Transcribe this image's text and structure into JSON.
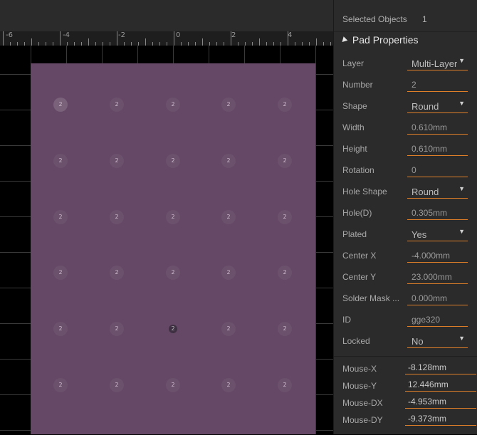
{
  "ruler": {
    "labels": [
      "-6",
      "-4",
      "-2",
      "0",
      "2",
      "4"
    ]
  },
  "pads": {
    "label": "2"
  },
  "panel": {
    "selected_label": "Selected Objects",
    "selected_count": "1",
    "section_title": "Pad Properties",
    "properties": [
      {
        "label": "Layer",
        "value": "Multi-Layer",
        "dropdown": true
      },
      {
        "label": "Number",
        "value": "2",
        "dropdown": false
      },
      {
        "label": "Shape",
        "value": "Round",
        "dropdown": true
      },
      {
        "label": "Width",
        "value": "0.610mm",
        "dropdown": false
      },
      {
        "label": "Height",
        "value": "0.610mm",
        "dropdown": false
      },
      {
        "label": "Rotation",
        "value": "0",
        "dropdown": false
      },
      {
        "label": "Hole Shape",
        "value": "Round",
        "dropdown": true
      },
      {
        "label": "Hole(D)",
        "value": "0.305mm",
        "dropdown": false
      },
      {
        "label": "Plated",
        "value": "Yes",
        "dropdown": true
      },
      {
        "label": "Center X",
        "value": "-4.000mm",
        "dropdown": false
      },
      {
        "label": "Center Y",
        "value": "23.000mm",
        "dropdown": false
      },
      {
        "label": "Solder Mask ...",
        "value": "0.000mm",
        "dropdown": false
      },
      {
        "label": "ID",
        "value": "gge320",
        "dropdown": false
      },
      {
        "label": "Locked",
        "value": "No",
        "dropdown": true
      }
    ],
    "mouse": [
      {
        "label": "Mouse-X",
        "value": "-8.128mm"
      },
      {
        "label": "Mouse-Y",
        "value": "12.446mm"
      },
      {
        "label": "Mouse-DX",
        "value": "-4.953mm"
      },
      {
        "label": "Mouse-DY",
        "value": "-9.373mm"
      }
    ]
  },
  "colors": {
    "board": "#654766",
    "accent": "#e07f2a",
    "panel": "#2b2b2b"
  }
}
